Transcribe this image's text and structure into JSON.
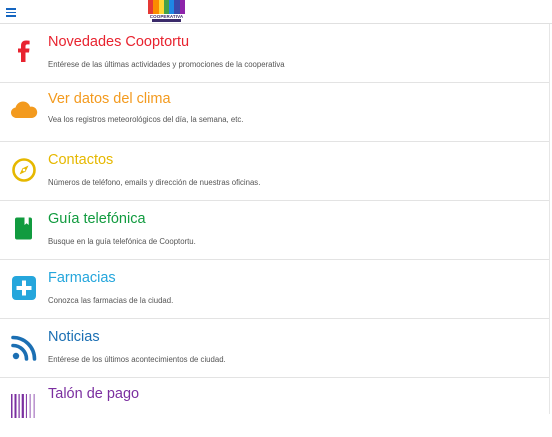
{
  "header": {
    "logo_text": "COOPERATIVA",
    "logo_colors": [
      "#e53935",
      "#fb8c00",
      "#fdd835",
      "#43a047",
      "#1e88e5",
      "#3949ab",
      "#8e24aa"
    ]
  },
  "menu": {
    "items": [
      {
        "title": "Novedades Cooptortu",
        "description": "Entérese de las últimas actividades y promociones de la cooperativa",
        "color": "#e8232f",
        "icon": "facebook-icon"
      },
      {
        "title": "Ver datos del clima",
        "description": "Vea los registros meteorológicos del día, la semana, etc.",
        "color": "#f39a1e",
        "icon": "cloud-icon"
      },
      {
        "title": "Contactos",
        "description": "Números de teléfono, emails y dirección de nuestras oficinas.",
        "color": "#e6b800",
        "icon": "compass-icon"
      },
      {
        "title": "Guía telefónica",
        "description": "Busque en la guía telefónica de Cooptortu.",
        "color": "#119b3f",
        "icon": "book-icon"
      },
      {
        "title": "Farmacias",
        "description": "Conozca las farmacias de la ciudad.",
        "color": "#25a6dc",
        "icon": "plus-icon"
      },
      {
        "title": "Noticias",
        "description": "Entérese de los últimos acontecimientos de ciudad.",
        "color": "#1b6fb3",
        "icon": "rss-icon"
      },
      {
        "title": "Talón de pago",
        "description": "",
        "color": "#7b2fa0",
        "icon": "barcode-icon"
      }
    ]
  }
}
